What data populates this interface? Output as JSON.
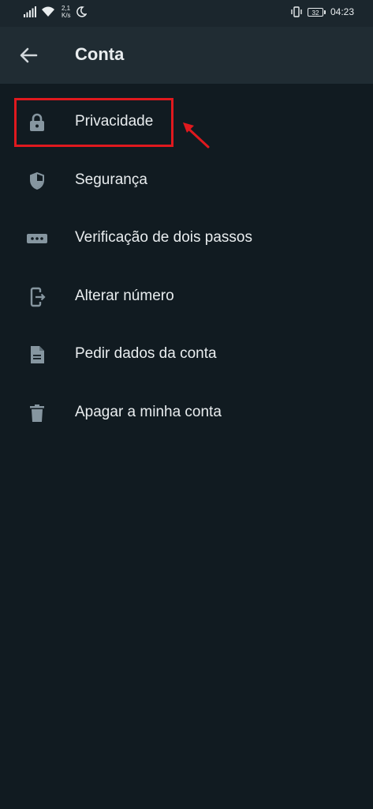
{
  "status_bar": {
    "speed_value": "2,1",
    "speed_unit": "K/s",
    "battery": "32",
    "time": "04:23"
  },
  "header": {
    "title": "Conta"
  },
  "menu": {
    "items": [
      {
        "label": "Privacidade",
        "icon": "lock-icon"
      },
      {
        "label": "Segurança",
        "icon": "shield-icon"
      },
      {
        "label": "Verificação de dois passos",
        "icon": "password-dots-icon"
      },
      {
        "label": "Alterar número",
        "icon": "phone-change-icon"
      },
      {
        "label": "Pedir dados da conta",
        "icon": "document-icon"
      },
      {
        "label": "Apagar a minha conta",
        "icon": "trash-icon"
      }
    ]
  },
  "colors": {
    "background": "#111b21",
    "app_bar": "#202c33",
    "text": "#e9edef",
    "icon": "#8696a0",
    "annotation": "#e0191e"
  }
}
